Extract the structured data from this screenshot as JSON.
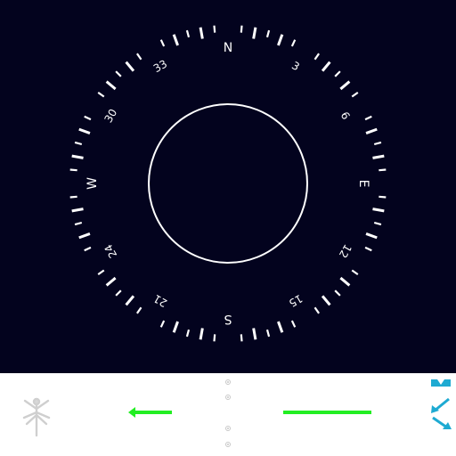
{
  "compass": {
    "heading_degrees": 0,
    "cardinals": [
      {
        "label": "N",
        "bearing": 0
      },
      {
        "label": "E",
        "bearing": 90
      },
      {
        "label": "S",
        "bearing": 180
      },
      {
        "label": "W",
        "bearing": 270
      }
    ],
    "numbers": [
      {
        "label": "3",
        "bearing": 30
      },
      {
        "label": "6",
        "bearing": 60
      },
      {
        "label": "12",
        "bearing": 120
      },
      {
        "label": "15",
        "bearing": 150
      },
      {
        "label": "21",
        "bearing": 210
      },
      {
        "label": "24",
        "bearing": 240
      },
      {
        "label": "30",
        "bearing": 300
      },
      {
        "label": "33",
        "bearing": 330
      }
    ],
    "tick_step_degrees": 5,
    "colors": {
      "background": "#03031e",
      "dial": "#ffffff"
    }
  },
  "controls": {
    "mode_icon": "dragonfly-icon",
    "back_arrow_icon": "left-arrow-icon",
    "indicator_icon": "dots-indicator-icon",
    "collapse_icon": "collapse-arrows-icon",
    "colors": {
      "arrow": "#22ee22",
      "collapse": "#1eaad2",
      "mode_icon": "#d0d0d0",
      "dots": "#c8c8c8"
    }
  }
}
